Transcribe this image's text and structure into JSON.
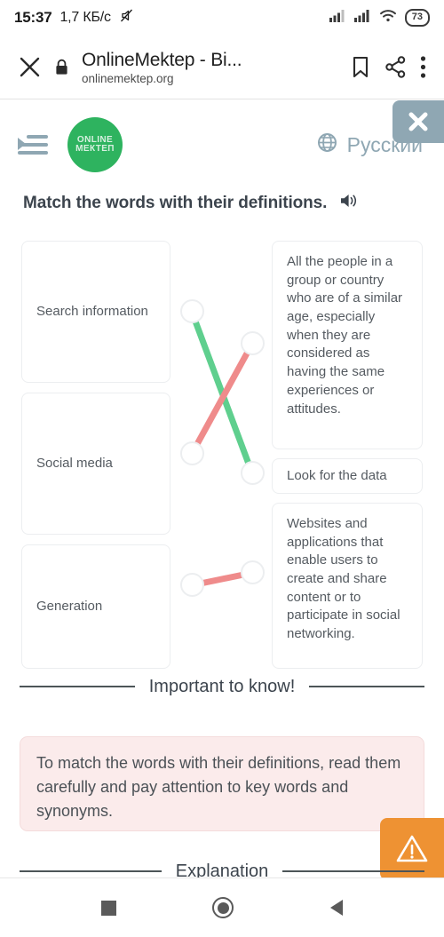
{
  "status_bar": {
    "time": "15:37",
    "data_rate": "1,7 КБ/с",
    "battery_level": "73",
    "icons": [
      "mute-icon",
      "signal-bars-icon",
      "signal-bars-icon",
      "wifi-icon",
      "battery-icon"
    ]
  },
  "browser_bar": {
    "close_label": "×",
    "page_title": "OnlineMektep - Bi...",
    "url": "onlinemektep.org",
    "icons": [
      "lock-icon",
      "bookmark-icon",
      "share-icon",
      "overflow-menu-icon"
    ]
  },
  "app_header": {
    "menu_icon": "hamburger-menu-icon",
    "logo_line1": "ONLINE",
    "logo_line2": "МЕКТЕП",
    "logo_color": "#2eb35f",
    "language": "Русский",
    "language_icon": "globe-icon",
    "close_button_color": "#8fa7b3"
  },
  "question": {
    "title": "Match the words with their definitions.",
    "audio_icon": "speaker-icon"
  },
  "match_exercise": {
    "terms": [
      {
        "label": "Search information"
      },
      {
        "label": "Social media"
      },
      {
        "label": "Generation"
      }
    ],
    "definitions": [
      {
        "label": "All the people in a group or country who are of a similar age, especially when they are considered as having the same experiences or attitudes."
      },
      {
        "label": "Look for the data"
      },
      {
        "label": "Websites and applications that enable users to create and share content or to participate in social networking."
      }
    ],
    "connections": [
      {
        "from": "Search information",
        "to": "Look for the data",
        "color": "#5fcf8e",
        "status": "correct"
      },
      {
        "from": "Social media",
        "to": "All the people in a group or country...",
        "color": "#ef8b8b",
        "status": "incorrect"
      },
      {
        "from": "Generation",
        "to": "Websites and applications that...",
        "color": "#ef8b8b",
        "status": "incorrect"
      }
    ]
  },
  "sections": [
    {
      "heading_line1": "Important to",
      "heading_line2": "know!"
    },
    {
      "heading_line1": "Explanation",
      "heading_line2": ""
    }
  ],
  "tip": {
    "text": "To match the words with their definitions, read them carefully and pay attention to key words and synonyms.",
    "background": "#fbebeb"
  },
  "warning_button": {
    "icon": "warning-triangle-icon",
    "color": "#ee9233"
  },
  "nav_bar": {
    "recent_icon": "square-recents-icon",
    "home_icon": "circle-home-icon",
    "back_icon": "triangle-back-icon"
  }
}
